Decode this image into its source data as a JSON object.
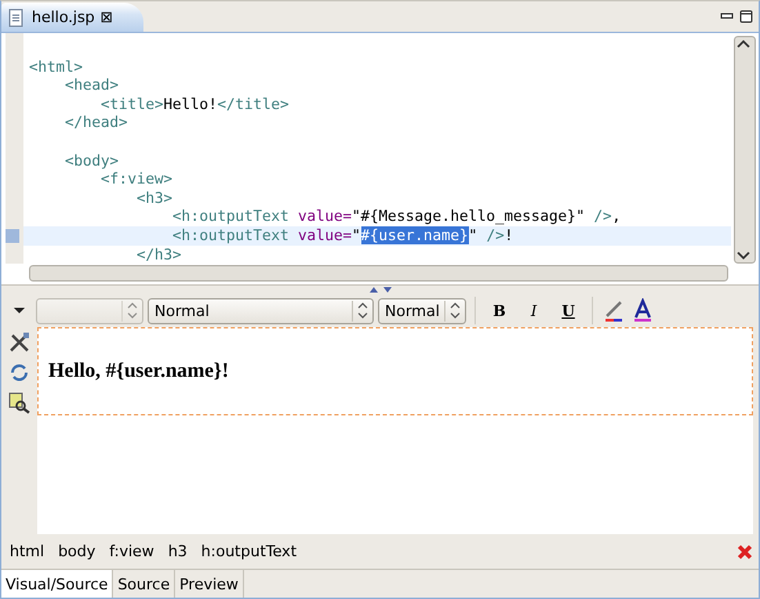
{
  "editor_tab": {
    "title": "hello.jsp",
    "close": "⊠"
  },
  "source": {
    "lines": [
      {
        "kind": "blank"
      },
      {
        "kind": "code",
        "current": false,
        "tokens": [
          {
            "kind": "tag",
            "text": "<html>"
          }
        ]
      },
      {
        "kind": "code",
        "current": false,
        "tokens": [
          {
            "kind": "tag",
            "text": "    <head>"
          }
        ]
      },
      {
        "kind": "code",
        "current": false,
        "tokens": [
          {
            "kind": "tag",
            "text": "        <title>"
          },
          {
            "kind": "text",
            "text": "Hello!"
          },
          {
            "kind": "tag",
            "text": "</title>"
          }
        ]
      },
      {
        "kind": "code",
        "current": false,
        "tokens": [
          {
            "kind": "tag",
            "text": "    </head>"
          }
        ]
      },
      {
        "kind": "blank"
      },
      {
        "kind": "code",
        "current": false,
        "tokens": [
          {
            "kind": "tag",
            "text": "    <body>"
          }
        ]
      },
      {
        "kind": "code",
        "current": false,
        "tokens": [
          {
            "kind": "tag",
            "text": "        <f:view>"
          }
        ]
      },
      {
        "kind": "code",
        "current": false,
        "tokens": [
          {
            "kind": "tag",
            "text": "            <h3>"
          }
        ]
      },
      {
        "kind": "code",
        "current": false,
        "tokens": [
          {
            "kind": "tag",
            "text": "                <h:outputText"
          },
          {
            "kind": "attr",
            "text": " value="
          },
          {
            "kind": "text",
            "text": "\"#{Message.hello_message}\""
          },
          {
            "kind": "tag",
            "text": " />"
          },
          {
            "kind": "text",
            "text": ","
          }
        ]
      },
      {
        "kind": "code",
        "current": true,
        "tokens": [
          {
            "kind": "tag",
            "text": "                <h:outputText"
          },
          {
            "kind": "attr",
            "text": " value="
          },
          {
            "kind": "text",
            "text": "\""
          },
          {
            "kind": "selected",
            "text": "#{user.name}"
          },
          {
            "kind": "text",
            "text": "\" "
          },
          {
            "kind": "tag",
            "text": "/>"
          },
          {
            "kind": "text",
            "text": "!"
          }
        ]
      },
      {
        "kind": "code",
        "current": false,
        "tokens": [
          {
            "kind": "tag",
            "text": "            </h3>"
          }
        ]
      }
    ]
  },
  "toolbar": {
    "style_combo": {
      "disabled": true
    },
    "format_combo": {
      "value": "Normal"
    },
    "size_combo": {
      "value": "Normal"
    },
    "bold": "B",
    "italic": "I",
    "underline": "U"
  },
  "visual": {
    "heading": "Hello, #{user.name}!"
  },
  "breadcrumb": [
    {
      "label": "html"
    },
    {
      "label": "body"
    },
    {
      "label": "f:view"
    },
    {
      "label": "h3"
    },
    {
      "label": "h:outputText"
    }
  ],
  "bottom_tabs": [
    {
      "label": "Visual/Source",
      "selected": true
    },
    {
      "label": "Source",
      "selected": false
    },
    {
      "label": "Preview",
      "selected": false
    }
  ]
}
